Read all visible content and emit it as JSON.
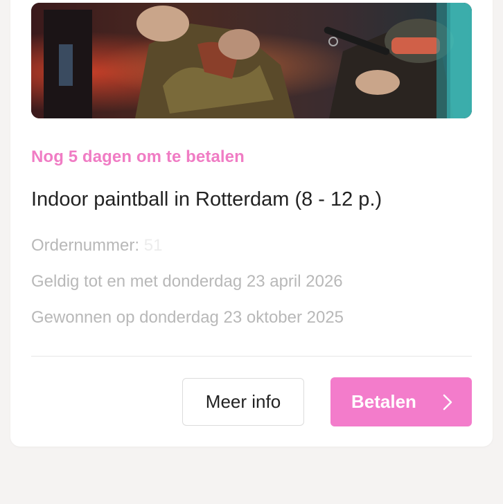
{
  "card": {
    "hero_image": "paintball-players-photo",
    "deadline": "Nog 5 dagen om te betalen",
    "title": "Indoor paintball in Rotterdam (8 - 12 p.)",
    "order_label": "Ordernummer:",
    "order_value": "51",
    "valid_until": "Geldig tot en met donderdag 23 april 2026",
    "won_on": "Gewonnen op donderdag 23 oktober 2025"
  },
  "actions": {
    "more_info": "Meer info",
    "pay": "Betalen",
    "pay_icon": "chevron-right-icon"
  },
  "colors": {
    "accent": "#f37ccb",
    "deadline": "#f07cc4",
    "title": "#222222",
    "meta": "#b8b8b8",
    "background": "#f5f3f2"
  }
}
